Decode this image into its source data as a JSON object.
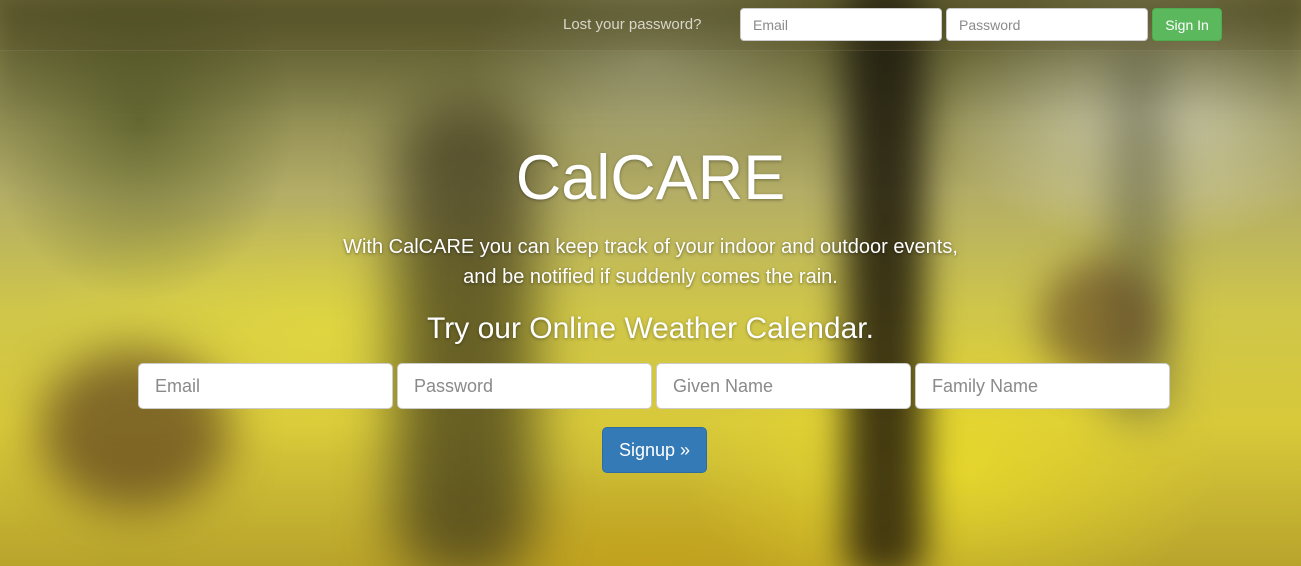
{
  "app": {
    "title": "CalCARE"
  },
  "navbar": {
    "lost_password_link": "Lost your password?",
    "email_placeholder": "Email",
    "password_placeholder": "Password",
    "signin_label": "Sign In",
    "signin_color": "#5cb85c"
  },
  "hero": {
    "title": "CalCARE",
    "description_line1": "With CalCARE you can keep track of your indoor and outdoor events,",
    "description_line2": "and be notified if suddenly comes the rain.",
    "subtitle": "Try our Online Weather Calendar."
  },
  "signup": {
    "email_placeholder": "Email",
    "password_placeholder": "Password",
    "given_name_placeholder": "Given Name",
    "family_name_placeholder": "Family Name",
    "button_label": "Signup »",
    "button_color": "#337ab7"
  }
}
